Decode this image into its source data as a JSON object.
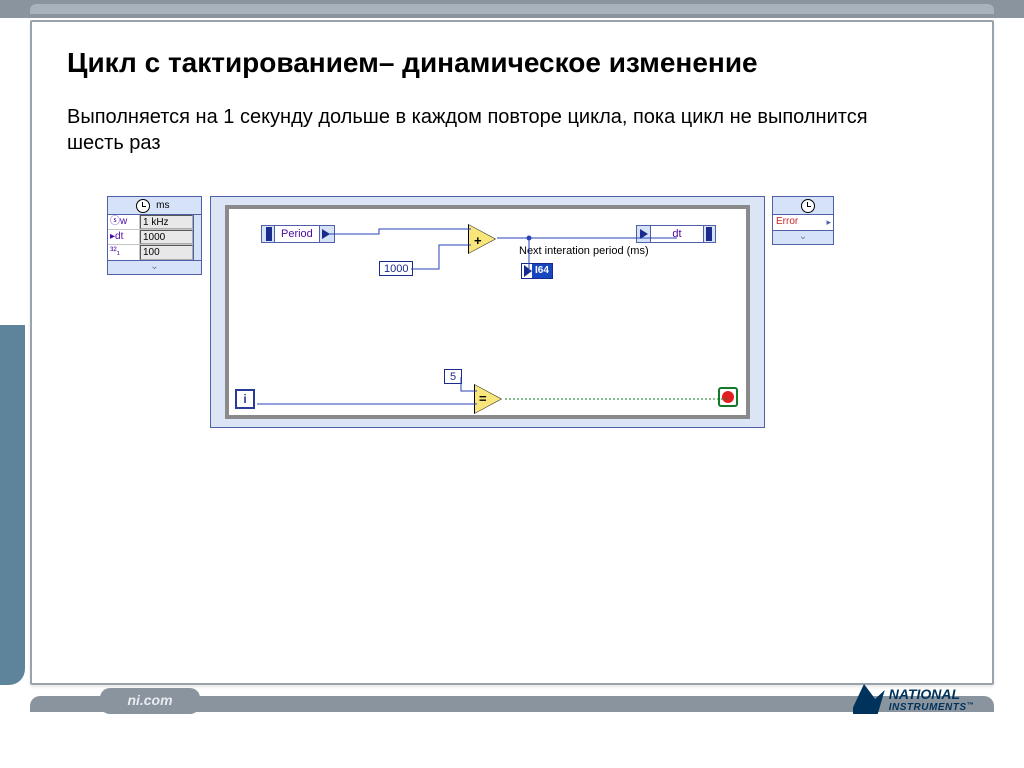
{
  "slide": {
    "title": "Цикл с тактированием– динамическое изменение",
    "subtitle": "Выполняется на 1 секунду дольше в каждом повторе цикла, пока цикл не выполнится шесть раз"
  },
  "left_node": {
    "unit": "ms",
    "rows": [
      {
        "label": "ⓢw",
        "value": "1 kHz"
      },
      {
        "label": "▸dt",
        "value": "1000"
      },
      {
        "label": "³²₁",
        "value": "100"
      }
    ]
  },
  "loop": {
    "period_label": "Period",
    "const_period_add": "1000",
    "next_iter_label": "Next interation period (ms)",
    "i64_label": "I64",
    "dt_label": "dt",
    "const_compare": "5",
    "iter_terminal": "i"
  },
  "right_node": {
    "row_label": "Error"
  },
  "footer": {
    "nicom": "ni.com",
    "logo_line1": "NATIONAL",
    "logo_line2": "INSTRUMENTS",
    "tm": "™"
  }
}
